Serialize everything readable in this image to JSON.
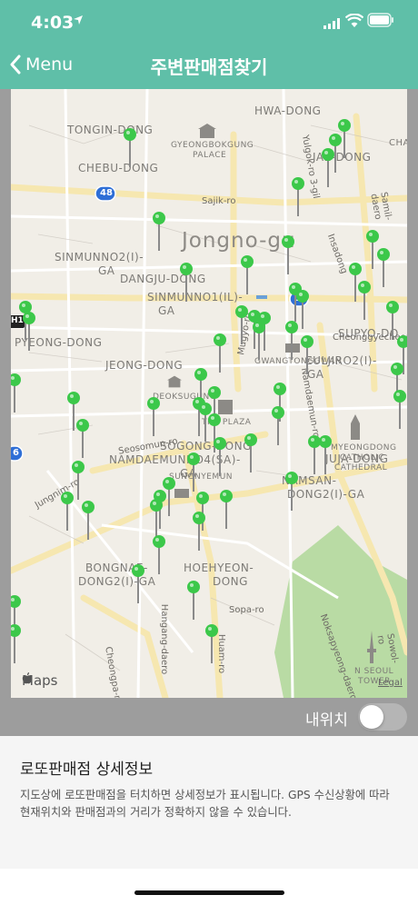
{
  "status": {
    "time": "4:03"
  },
  "nav": {
    "back_label": "Menu",
    "title": "주변판매점찾기"
  },
  "map": {
    "district": "Jongno-gu",
    "areas": [
      "TONGIN-DONG",
      "HWA-DONG",
      "JAE-DONG",
      "CHEBU-DONG",
      "SINMUNNO2(I)-",
      "GA",
      "DANGJU-DONG",
      "SINMUNNO1(IL)-",
      "GA",
      "PYEONG-DONG",
      "JEONG-DONG",
      "SOGONG-DONG",
      "NAMDAEMUNNO4(SA)-",
      "GA",
      "BONGNAE-",
      "DONG2(I)-GA",
      "HOEHYEON-",
      "DONG",
      "NAMSAN-",
      "DONG2(I)-GA",
      "JUJA-DONG",
      "SUPYO-DO",
      "EULJIRO2(I)-",
      "GA",
      "CHA"
    ],
    "landmarks": [
      "GYEONGBOKGUNG",
      "PALACE",
      "DEOKSUGUNG",
      "THE PLAZA",
      "GWANGTONGGWAN",
      "MYEONGDONG",
      "CATHOLIC",
      "CATHEDRAL",
      "N SEOUL",
      "TOWER",
      "SUNGNYEMUN"
    ],
    "roads": [
      "Sajik-ro",
      "Seosomun-ro",
      "Cheonggyecheon",
      "Sopa-ro",
      "Hangang-daero",
      "Cheongpa-ro",
      "Huam-ro",
      "Noksapyeong-daero",
      "Yulgok-ro 3-gil",
      "Samil-daero",
      "Insadong",
      "Jungnim-ro",
      "Namdaemun-ro",
      "Mugyo-ro",
      "Sowol-ro"
    ],
    "route_badges": [
      "48",
      "1",
      "6",
      "H1"
    ],
    "brand": "Maps",
    "legal": "Legal",
    "pin_color": "#3cc84a"
  },
  "toggle": {
    "label": "내위치",
    "on": false
  },
  "detail": {
    "title": "로또판매점 상세정보",
    "description": "지도상에 로또판매점을 터치하면 상세정보가 표시됩니다. GPS 수신상황에 따라 현재위치와 판매점과의 거리가 정확하지 않을 수 있습니다."
  }
}
